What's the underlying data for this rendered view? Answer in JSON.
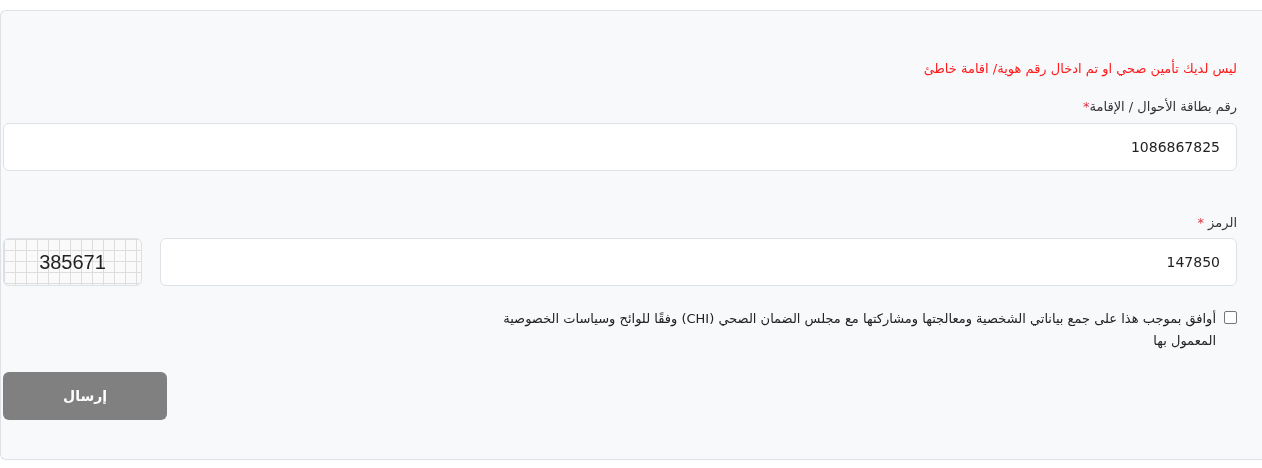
{
  "error_message": "ليس لديك تأمين صحي او تم ادخال رقم هوية/ اقامة خاطئ",
  "id_field": {
    "label": "رقم بطاقة الأحوال / الإقامة",
    "required_mark": "*",
    "value": "1086867825"
  },
  "code_field": {
    "label": "الرمز",
    "required_mark": "*",
    "value": "147850",
    "captcha": "385671"
  },
  "consent": {
    "checked": false,
    "text": "أوافق بموجب هذا على جمع بياناتي الشخصية ومعالجتها ومشاركتها مع مجلس الضمان الصحي (CHI) وفقًا للوائح وسياسات الخصوصية المعمول بها"
  },
  "submit": {
    "label": "إرسال",
    "disabled": true
  }
}
